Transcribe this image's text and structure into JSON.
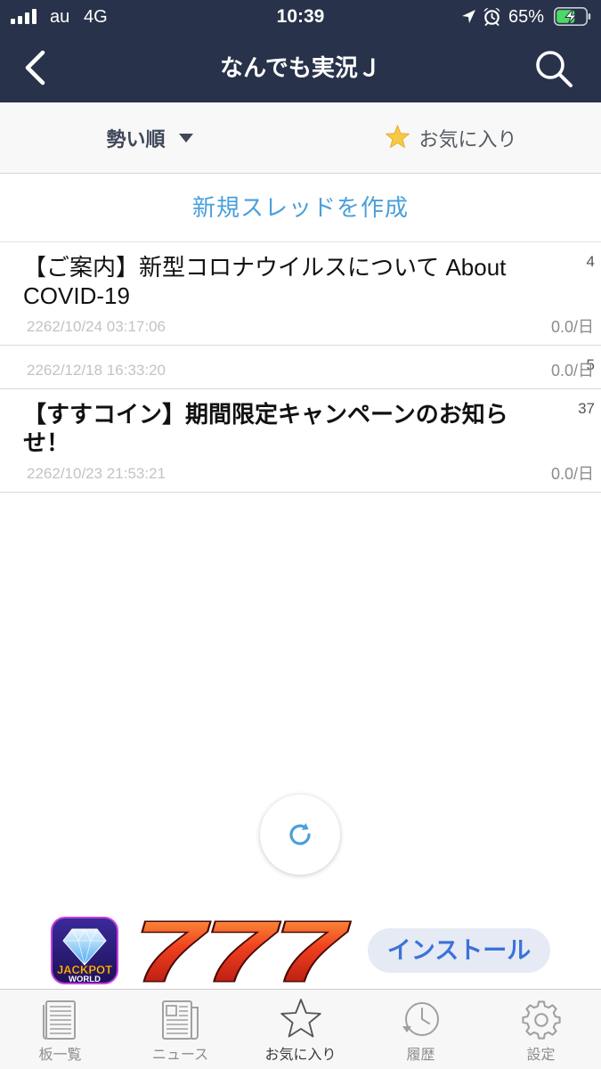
{
  "status_bar": {
    "carrier": "au",
    "network": "4G",
    "time": "10:39",
    "battery_text": "65%",
    "battery_level": 65,
    "icons": [
      "signal-bars-icon",
      "location-arrow-icon",
      "alarm-icon",
      "battery-charging-icon"
    ]
  },
  "nav": {
    "title": "なんでも実況Ｊ",
    "back_icon": "chevron-left-icon",
    "search_icon": "search-icon"
  },
  "sort_bar": {
    "sort_label": "勢い順",
    "sort_icon": "caret-down-icon",
    "favorites_label": "お気に入り",
    "favorites_icon": "star-icon"
  },
  "new_thread": {
    "label": "新規スレッドを作成"
  },
  "threads": [
    {
      "title": "【ご案内】新型コロナウイルスについて About COVID-19",
      "count": 4,
      "date": "2262/10/24 03:17:06",
      "speed": "0.0/日"
    },
    {
      "count": 5,
      "date": "2262/12/18 16:33:20",
      "speed": "0.0/日"
    },
    {
      "title": "【すすコイン】期間限定キャンペーンのお知らせ！",
      "count": 37,
      "date": "2262/10/23 21:53:21",
      "speed": "0.0/日"
    }
  ],
  "refresh": {
    "icon": "refresh-icon"
  },
  "ad": {
    "app_icon_text": [
      "JACKPOT",
      "WORLD"
    ],
    "promo_text": "777",
    "install_label": "インストール"
  },
  "tab_bar": {
    "tabs": [
      {
        "label": "板一覧",
        "icon": "board-list-icon"
      },
      {
        "label": "ニュース",
        "icon": "news-icon"
      },
      {
        "label": "お気に入り",
        "icon": "star-outline-icon"
      },
      {
        "label": "履歴",
        "icon": "history-clock-icon"
      },
      {
        "label": "設定",
        "icon": "gear-icon"
      }
    ],
    "active_index": 2
  },
  "theme": {
    "nav_bg": "#28324a",
    "accent": "#4a9fdc",
    "favorite_star": "#f6c945",
    "install_button_bg": "#e6eaf4",
    "install_button_text": "#3b72d9",
    "battery_fill": "#4cd964"
  }
}
